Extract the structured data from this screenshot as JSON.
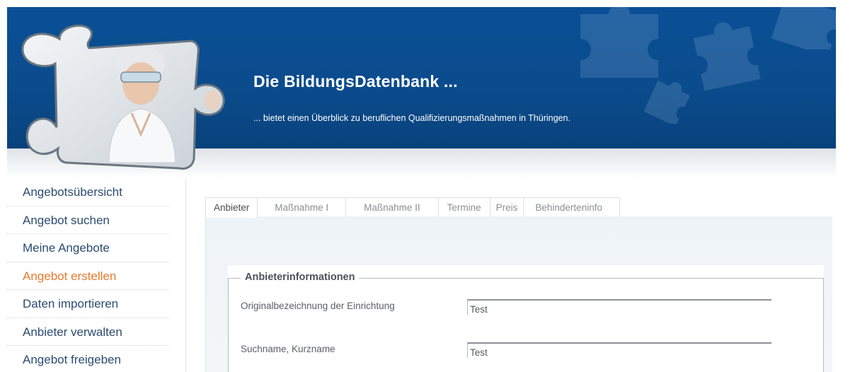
{
  "header": {
    "title": "Die BildungsDatenbank ...",
    "subtitle": "... bietet einen Überblick zu beruflichen Qualifizierungsmaßnahmen in Thüringen."
  },
  "sidebar": {
    "items": [
      {
        "label": "Angebotsübersicht"
      },
      {
        "label": "Angebot suchen"
      },
      {
        "label": "Meine Angebote"
      },
      {
        "label": "Angebot erstellen",
        "active": true
      },
      {
        "label": "Daten importieren"
      },
      {
        "label": "Anbieter verwalten"
      },
      {
        "label": "Angebot freigeben"
      }
    ]
  },
  "tabs": [
    {
      "label": "Anbieter",
      "active": true
    },
    {
      "label": "Maßnahme I"
    },
    {
      "label": "Maßnahme II"
    },
    {
      "label": "Termine"
    },
    {
      "label": "Preis"
    },
    {
      "label": "Behinderteninfo"
    }
  ],
  "form": {
    "legend": "Anbieterinformationen",
    "fields": [
      {
        "label": "Originalbezeichnung der Einrichtung",
        "value": "Test"
      },
      {
        "label": "Suchname, Kurzname",
        "value": "Test"
      }
    ]
  },
  "colors": {
    "header_blue": "#0b4c8d",
    "active_nav": "#e8792a",
    "nav_text": "#2c4b70"
  },
  "icons": {
    "logo": "puzzle-piece-photo-icon",
    "decoration": "puzzle-piece-icon"
  }
}
